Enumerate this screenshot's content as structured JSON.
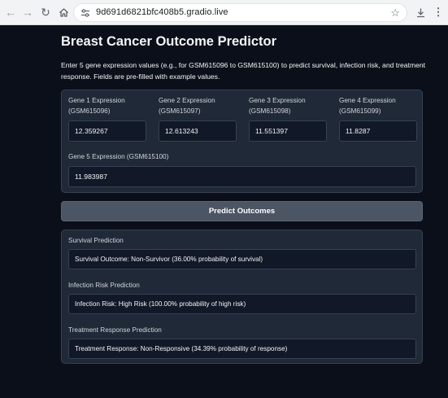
{
  "browser": {
    "url": "9d691d6821bfc408b5.gradio.live",
    "back_icon": "back-arrow-icon",
    "forward_icon": "forward-arrow-icon",
    "reload_icon": "reload-icon",
    "home_icon": "home-icon"
  },
  "app": {
    "title": "Breast Cancer Outcome Predictor",
    "description": "Enter 5 gene expression values (e.g., for GSM615096 to GSM615100) to predict survival, infection risk, and treatment response. Fields are pre-filled with example values."
  },
  "genes": [
    {
      "label": "Gene 1 Expression (GSM615096)",
      "value": "12.359267"
    },
    {
      "label": "Gene 2 Expression (GSM615097)",
      "value": "12.613243"
    },
    {
      "label": "Gene 3 Expression (GSM615098)",
      "value": "11.551397"
    },
    {
      "label": "Gene 4 Expression (GSM615099)",
      "value": "11.8287"
    },
    {
      "label": "Gene 5 Expression (GSM615100)",
      "value": "11.983987"
    }
  ],
  "predict_button": "Predict Outcomes",
  "outputs": [
    {
      "label": "Survival Prediction",
      "value": "Survival Outcome: Non-Survivor (36.00% probability of survival)"
    },
    {
      "label": "Infection Risk Prediction",
      "value": "Infection Risk: High Risk (100.00% probability of high risk)"
    },
    {
      "label": "Treatment Response Prediction",
      "value": "Treatment Response: Non-Responsive (34.39% probability of response)"
    }
  ],
  "colors": {
    "page_background": "#0b0f19",
    "block_background": "#1f2937",
    "button_background": "#4b5563"
  }
}
